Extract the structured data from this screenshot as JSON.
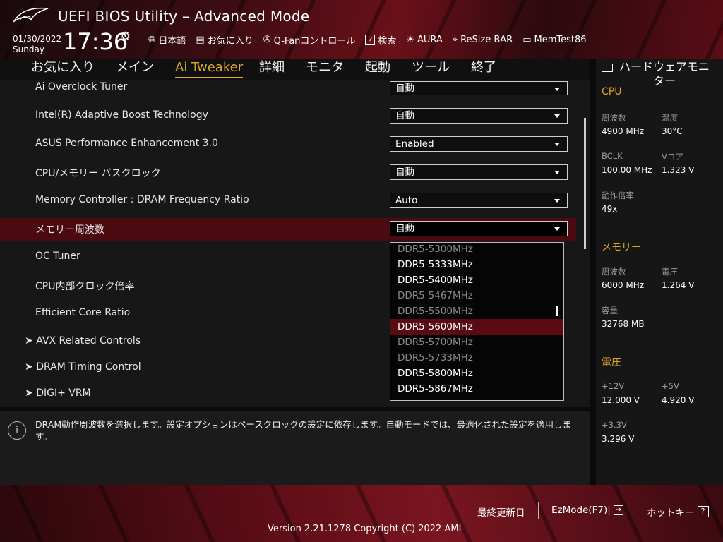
{
  "header": {
    "title": "UEFI BIOS Utility – Advanced Mode",
    "date": "01/30/2022",
    "weekday": "Sunday",
    "time": "17:36",
    "tools": [
      {
        "icon": "globe-icon",
        "label": "日本語"
      },
      {
        "icon": "favorites-icon",
        "label": "お気に入り"
      },
      {
        "icon": "fan-icon",
        "label": "Q-Fanコントロール"
      },
      {
        "icon": "search-icon",
        "label": "検索"
      },
      {
        "icon": "aura-icon",
        "label": "AURA"
      },
      {
        "icon": "resize-bar-icon",
        "label": "ReSize BAR"
      },
      {
        "icon": "memtest-icon",
        "label": "MemTest86"
      }
    ]
  },
  "tabs": [
    "お気に入り",
    "メイン",
    "Ai Tweaker",
    "詳細",
    "モニタ",
    "起動",
    "ツール",
    "終了"
  ],
  "active_tab": "Ai Tweaker",
  "settings": [
    {
      "label": "Ai Overclock Tuner",
      "value": "自動"
    },
    {
      "label": "Intel(R) Adaptive Boost Technology",
      "value": "自動"
    },
    {
      "label": "ASUS Performance Enhancement 3.0",
      "value": "Enabled"
    },
    {
      "label": "CPU/メモリー バスクロック",
      "value": "自動"
    },
    {
      "label": "Memory Controller : DRAM Frequency Ratio",
      "value": "Auto"
    },
    {
      "label": "メモリー周波数",
      "value": "自動"
    },
    {
      "label": "OC Tuner",
      "value": ""
    },
    {
      "label": "CPU内部クロック倍率",
      "value": ""
    },
    {
      "label": "Efficient Core Ratio",
      "value": ""
    }
  ],
  "submenus": [
    "AVX Related Controls",
    "DRAM Timing Control",
    "DIGI+ VRM"
  ],
  "dropdown_options": [
    {
      "label": "DDR5-5300MHz",
      "state": "dim"
    },
    {
      "label": "DDR5-5333MHz",
      "state": "on"
    },
    {
      "label": "DDR5-5400MHz",
      "state": "on"
    },
    {
      "label": "DDR5-5467MHz",
      "state": "dim"
    },
    {
      "label": "DDR5-5500MHz",
      "state": "dim"
    },
    {
      "label": "DDR5-5600MHz",
      "state": "cur"
    },
    {
      "label": "DDR5-5700MHz",
      "state": "dim"
    },
    {
      "label": "DDR5-5733MHz",
      "state": "dim"
    },
    {
      "label": "DDR5-5800MHz",
      "state": "on"
    },
    {
      "label": "DDR5-5867MHz",
      "state": "on"
    }
  ],
  "help_text": "DRAM動作周波数を選択します。設定オプションはベースクロックの設定に依存します。自動モードでは、最適化された設定を適用します。",
  "monitor": {
    "title": "ハードウェアモニター",
    "cpu": {
      "title": "CPU",
      "freq_k": "周波数",
      "freq_v": "4900 MHz",
      "temp_k": "温度",
      "temp_v": "30°C",
      "bclk_k": "BCLK",
      "bclk_v": "100.00 MHz",
      "vcore_k": "Vコア",
      "vcore_v": "1.323 V",
      "ratio_k": "動作倍率",
      "ratio_v": "49x"
    },
    "memory": {
      "title": "メモリー",
      "freq_k": "周波数",
      "freq_v": "6000 MHz",
      "volt_k": "電圧",
      "volt_v": "1.264 V",
      "cap_k": "容量",
      "cap_v": "32768 MB"
    },
    "voltage": {
      "title": "電圧",
      "v12_k": "+12V",
      "v12_v": "12.000 V",
      "v5_k": "+5V",
      "v5_v": "4.920 V",
      "v33_k": "+3.3V",
      "v33_v": "3.296 V"
    }
  },
  "footer": {
    "last_modified": "最終更新日",
    "ezmode": "EzMode(F7)|",
    "hotkeys": "ホットキー",
    "hotkey_glyph": "?",
    "version": "Version 2.21.1278 Copyright (C) 2022 AMI"
  },
  "colors": {
    "accent": "#e0a525",
    "selection": "#4a0a10",
    "brand_red": "#6b1018"
  }
}
